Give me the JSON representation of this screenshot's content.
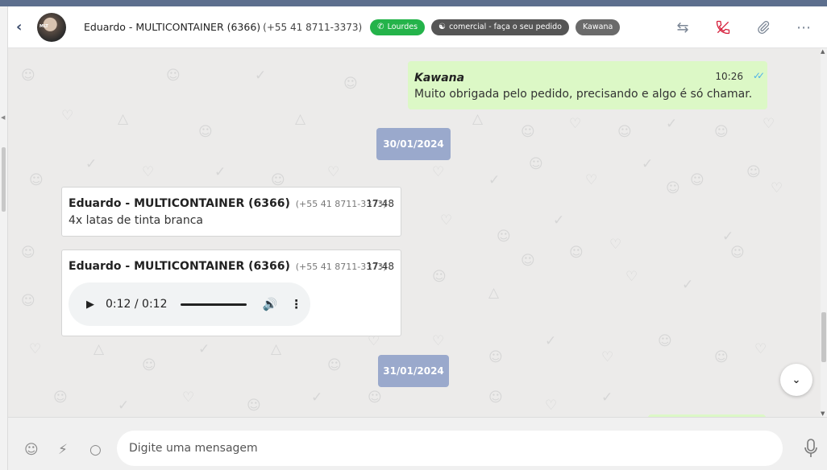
{
  "header": {
    "contact_name": "Eduardo - MULTICONTAINER (6366)",
    "contact_phone": "(+55 41 8711-3373)",
    "tags": [
      {
        "label": "Lourdes",
        "icon": "whatsapp-icon",
        "color": "#24b34a"
      },
      {
        "label": "comercial - faça o seu pedido",
        "icon": "sitemap-icon",
        "color": "#555555"
      },
      {
        "label": "Kawana",
        "icon": "",
        "color": "#6a6a6a"
      }
    ],
    "actions": [
      "transfer-icon",
      "end-call-icon",
      "attach-icon",
      "more-icon"
    ]
  },
  "messages": {
    "outgoing_1": {
      "author": "Kawana",
      "time": "10:26",
      "text": "Muito obrigada pelo pedido, precisando e algo é só chamar."
    },
    "date_1": "30/01/2024",
    "incoming_1": {
      "author": "Eduardo - MULTICONTAINER (6366)",
      "phone": "(+55 41 8711-3373)",
      "time": "17:48",
      "text": "4x latas de tinta branca"
    },
    "incoming_2": {
      "author": "Eduardo - MULTICONTAINER (6366)",
      "phone": "(+55 41 8711-3373)",
      "time": "17:48",
      "audio_time": "0:12 / 0:12"
    },
    "date_2": "31/01/2024"
  },
  "composer": {
    "placeholder": "Digite uma mensagem"
  },
  "colors": {
    "outgoing_bubble": "#dcf8c6",
    "date_chip": "#9aa9cc",
    "tag_green": "#24b34a",
    "end_call": "#d61f3b"
  }
}
